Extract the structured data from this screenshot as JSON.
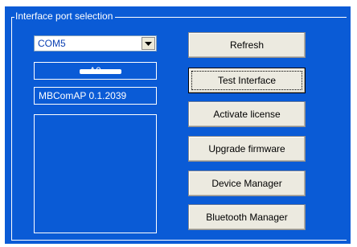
{
  "groupbox": {
    "title": "Interface port selection"
  },
  "port_select": {
    "selected": "COM5"
  },
  "serial": {
    "text": "A0"
  },
  "version": {
    "text": "MBComAP 0.1.2039"
  },
  "buttons": {
    "refresh": "Refresh",
    "test_interface": "Test Interface",
    "activate_license": "Activate license",
    "upgrade_firmware": "Upgrade firmware",
    "device_manager": "Device Manager",
    "bluetooth_manager": "Bluetooth Manager"
  },
  "colors": {
    "panel_background": "#0a5bd6",
    "button_face": "#eceae0"
  },
  "icons": {
    "dropdown": "chevron-down-icon"
  }
}
